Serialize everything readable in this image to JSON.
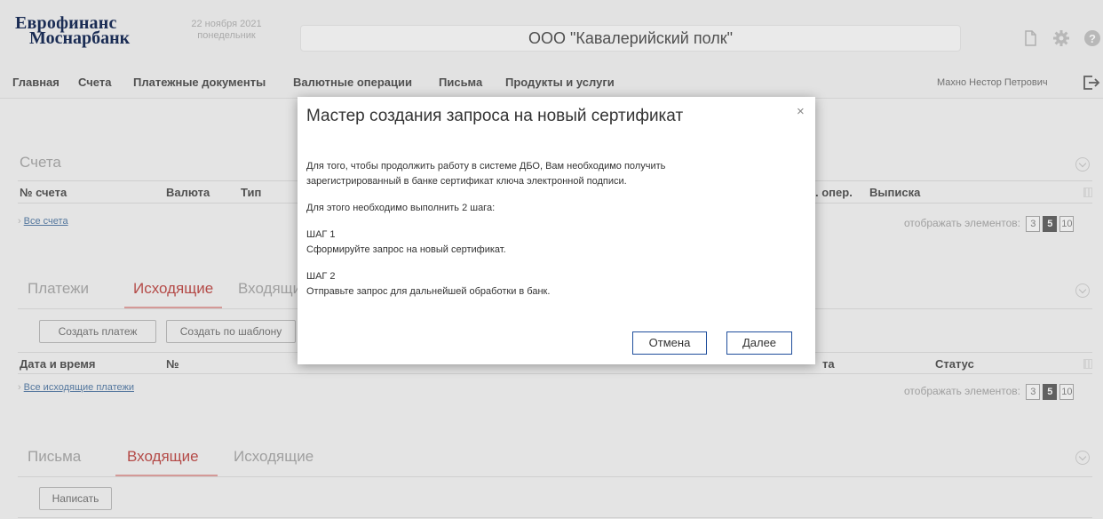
{
  "header": {
    "logo_line1": "Еврофинанс",
    "logo_line2": "Моснарбанк",
    "date": "22 ноября 2021",
    "weekday": "понедельник",
    "company": "ООО \"Кавалерийский полк\"",
    "icons": [
      "document-icon",
      "gear-icon",
      "help-icon"
    ]
  },
  "nav": {
    "items": [
      "Главная",
      "Счета",
      "Платежные документы",
      "Валютные операции",
      "Письма",
      "Продукты и услуги"
    ],
    "user": "Махно Нестор Петрович"
  },
  "accounts": {
    "title": "Счета",
    "columns": [
      "№ счета",
      "Валюта",
      "Тип",
      ". опер.",
      "Выписка"
    ],
    "all_link": "Все счета",
    "pager_label": "отображать элементов:",
    "pager_options": [
      "3",
      "5",
      "10"
    ],
    "pager_selected": "5"
  },
  "payments": {
    "title": "Платежи",
    "tabs": [
      "Исходящие",
      "Входящие"
    ],
    "buttons": [
      "Создать платеж",
      "Создать по шаблону"
    ],
    "columns": [
      "Дата и время",
      "№",
      "та",
      "Статус"
    ],
    "all_link": "Все исходящие платежи",
    "pager_label": "отображать элементов:",
    "pager_options": [
      "3",
      "5",
      "10"
    ],
    "pager_selected": "5"
  },
  "letters": {
    "title": "Письма",
    "tabs": [
      "Входящие",
      "Исходящие"
    ],
    "button": "Написать"
  },
  "modal": {
    "title": "Мастер создания запроса на новый сертификат",
    "close": "×",
    "paragraph1_line1": "Для того, чтобы продолжить работу в системе ДБО, Вам необходимо получить",
    "paragraph1_line2": "зарегистрированный в банке сертификат ключа электронной подписи.",
    "paragraph2": "Для этого необходимо выполнить 2 шага:",
    "step1_title": "ШАГ 1",
    "step1_text": "Сформируйте запрос на новый сертификат.",
    "step2_title": "ШАГ 2",
    "step2_text": "Отправьте запрос для дальнейшей обработки в банк.",
    "cancel": "Отмена",
    "next": "Далее"
  }
}
